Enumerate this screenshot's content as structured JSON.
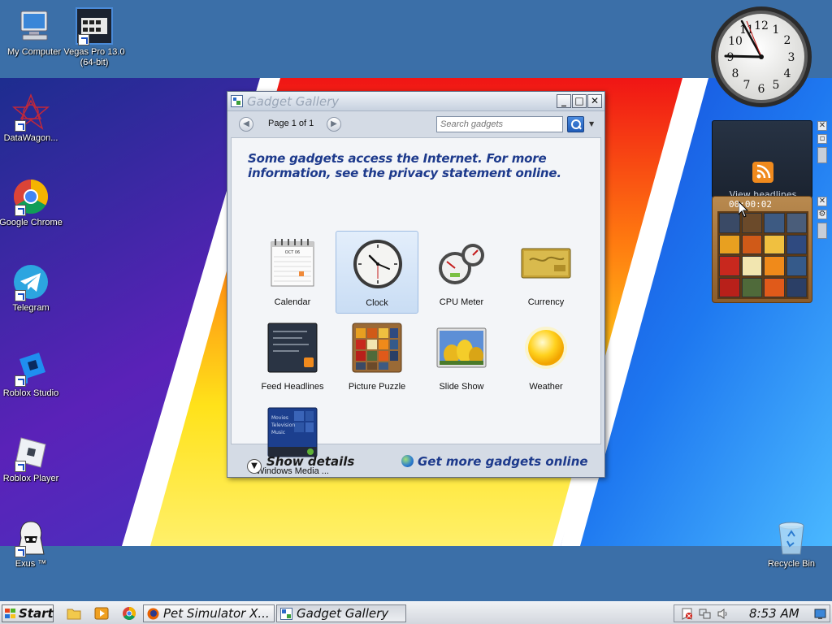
{
  "desktop": {
    "icons": [
      {
        "label": "My Computer",
        "icon": "computer-icon"
      },
      {
        "label": "Vegas Pro 13.0 (64-bit)",
        "icon": "film-icon"
      },
      {
        "label": "DataWagon...",
        "icon": "datawagon-icon"
      },
      {
        "label": "Google Chrome",
        "icon": "chrome-icon"
      },
      {
        "label": "Telegram",
        "icon": "telegram-icon"
      },
      {
        "label": "Roblox Studio",
        "icon": "roblox-studio-icon"
      },
      {
        "label": "Roblox Player",
        "icon": "roblox-player-icon"
      },
      {
        "label": "Exus ™",
        "icon": "exus-icon"
      },
      {
        "label": "Recycle Bin",
        "icon": "recycle-bin-icon"
      }
    ]
  },
  "gadgets": {
    "feed_headlines": {
      "text": "View headlines"
    },
    "picture_puzzle": {
      "timer": "00:00:02"
    }
  },
  "gallery": {
    "title": "Gadget Gallery",
    "page_label": "Page 1 of 1",
    "search_placeholder": "Search gadgets",
    "notice": "Some gadgets access the Internet.  For more information, see the privacy statement online.",
    "items": [
      {
        "label": "Calendar",
        "icon": "calendar-icon",
        "selected": false
      },
      {
        "label": "Clock",
        "icon": "clock-icon",
        "selected": true
      },
      {
        "label": "CPU Meter",
        "icon": "cpu-meter-icon",
        "selected": false
      },
      {
        "label": "Currency",
        "icon": "currency-icon",
        "selected": false
      },
      {
        "label": "Feed Headlines",
        "icon": "feed-headlines-icon",
        "selected": false
      },
      {
        "label": "Picture Puzzle",
        "icon": "picture-puzzle-icon",
        "selected": false
      },
      {
        "label": "Slide Show",
        "icon": "slide-show-icon",
        "selected": false
      },
      {
        "label": "Weather",
        "icon": "weather-icon",
        "selected": false
      },
      {
        "label": "Windows Media ...",
        "icon": "windows-media-center-icon",
        "selected": false
      }
    ],
    "thumb_text": {
      "calendar_month": "OCT 06",
      "media_lines": [
        "Movies",
        "Television",
        "Music"
      ]
    },
    "show_details": "Show details",
    "get_more": "Get more gadgets online"
  },
  "taskbar": {
    "start_label": "Start",
    "tasks": [
      {
        "label": "Pet Simulator X...",
        "icon": "firefox-icon",
        "active": false
      },
      {
        "label": "Gadget Gallery",
        "icon": "gadget-gallery-icon",
        "active": true
      }
    ],
    "time": "8:53 AM"
  },
  "colors": {
    "desktop_bg": "#3b6fa8",
    "title_text": "#1d3a8c",
    "selection": "#c9ddf4"
  }
}
